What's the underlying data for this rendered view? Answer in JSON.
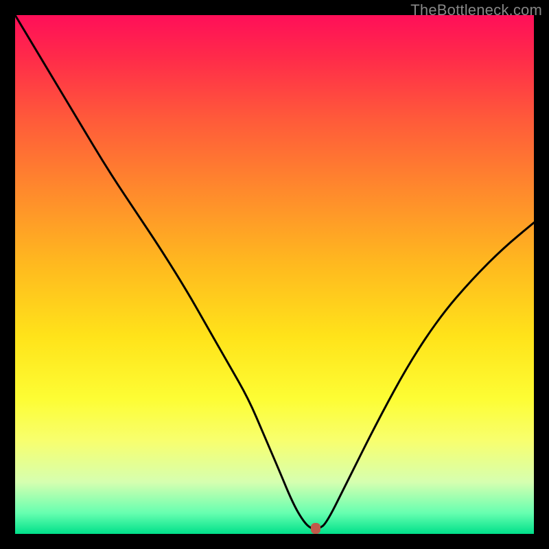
{
  "watermark": "TheBottleneck.com",
  "colors": {
    "frame_bg": "#000000",
    "curve_stroke": "#000000",
    "marker_fill": "#c05a4a"
  },
  "chart_data": {
    "type": "line",
    "title": "",
    "xlabel": "",
    "ylabel": "",
    "xlim": [
      0,
      100
    ],
    "ylim": [
      0,
      100
    ],
    "series": [
      {
        "name": "bottleneck-curve",
        "x": [
          0,
          6,
          12,
          18,
          24,
          28,
          33,
          37,
          41,
          45,
          48,
          51,
          53.5,
          55.5,
          57,
          58.5,
          60,
          64,
          70,
          76,
          82,
          88,
          94,
          100
        ],
        "y": [
          100,
          90,
          80,
          70,
          61,
          55,
          47,
          40,
          33,
          26,
          19,
          12,
          6,
          2.5,
          1,
          1,
          2,
          10,
          22,
          33,
          42,
          49,
          55,
          60
        ]
      }
    ],
    "marker": {
      "x": 58,
      "y": 1
    }
  }
}
